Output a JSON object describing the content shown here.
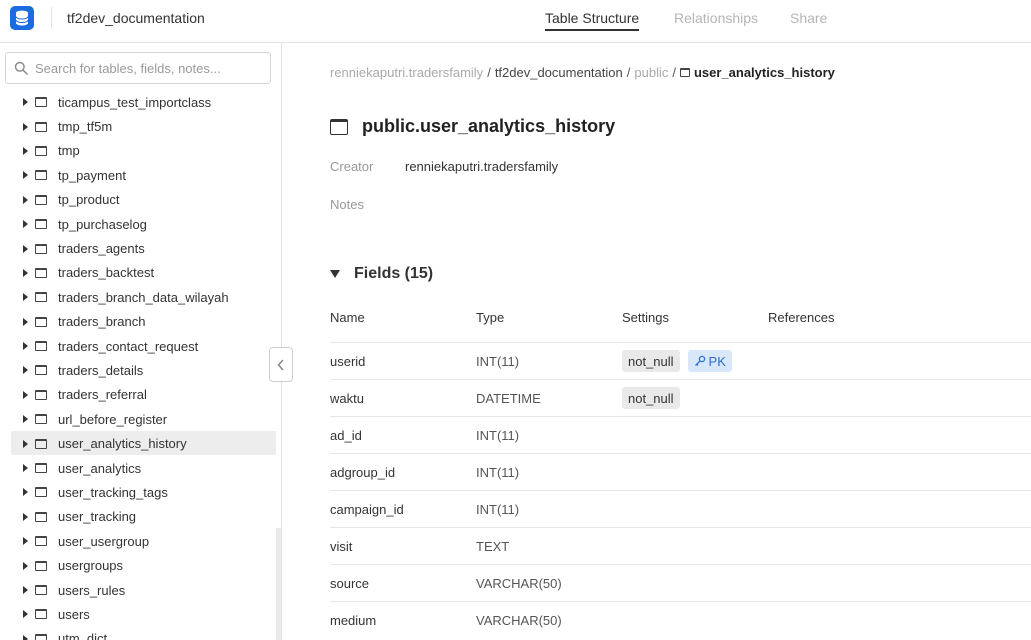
{
  "header": {
    "app_title": "tf2dev_documentation",
    "tabs": [
      {
        "label": "Table Structure",
        "active": true
      },
      {
        "label": "Relationships",
        "active": false
      },
      {
        "label": "Share",
        "active": false
      }
    ]
  },
  "sidebar": {
    "search_placeholder": "Search for tables, fields, notes...",
    "tables": [
      "ticampus_test_importclass",
      "tmp_tf5m",
      "tmp",
      "tp_payment",
      "tp_product",
      "tp_purchaselog",
      "traders_agents",
      "traders_backtest",
      "traders_branch_data_wilayah",
      "traders_branch",
      "traders_contact_request",
      "traders_details",
      "traders_referral",
      "url_before_register",
      "user_analytics_history",
      "user_analytics",
      "user_tracking_tags",
      "user_tracking",
      "user_usergroup",
      "usergroups",
      "users_rules",
      "users",
      "utm_dict"
    ],
    "selected": "user_analytics_history"
  },
  "breadcrumb": {
    "owner": "renniekaputri.tradersfamily",
    "project": "tf2dev_documentation",
    "schema": "public",
    "table": "user_analytics_history"
  },
  "table_detail": {
    "title": "public.user_analytics_history",
    "creator_label": "Creator",
    "creator_value": "renniekaputri.tradersfamily",
    "notes_label": "Notes",
    "fields_title": "Fields (15)",
    "columns": [
      "Name",
      "Type",
      "Settings",
      "References"
    ],
    "fields": [
      {
        "name": "userid",
        "type": "INT(11)",
        "settings": [
          "not_null"
        ],
        "pk": "PK"
      },
      {
        "name": "waktu",
        "type": "DATETIME",
        "settings": [
          "not_null"
        ],
        "pk": ""
      },
      {
        "name": "ad_id",
        "type": "INT(11)",
        "settings": [],
        "pk": ""
      },
      {
        "name": "adgroup_id",
        "type": "INT(11)",
        "settings": [],
        "pk": ""
      },
      {
        "name": "campaign_id",
        "type": "INT(11)",
        "settings": [],
        "pk": ""
      },
      {
        "name": "visit",
        "type": "TEXT",
        "settings": [],
        "pk": ""
      },
      {
        "name": "source",
        "type": "VARCHAR(50)",
        "settings": [],
        "pk": ""
      },
      {
        "name": "medium",
        "type": "VARCHAR(50)",
        "settings": [],
        "pk": ""
      }
    ]
  },
  "colors": {
    "brand": "#1a6ce0",
    "pk_badge_bg": "#d9e7fb",
    "pk_badge_text": "#2c6fd1",
    "badge_bg": "#e9e9e9",
    "selected_row": "#ededed"
  },
  "icons": {
    "logo": "database-icon",
    "search": "search-icon",
    "table": "table-icon",
    "collapse": "chevron-left-icon",
    "pk": "key-icon",
    "fields_toggle": "triangle-down-icon"
  }
}
